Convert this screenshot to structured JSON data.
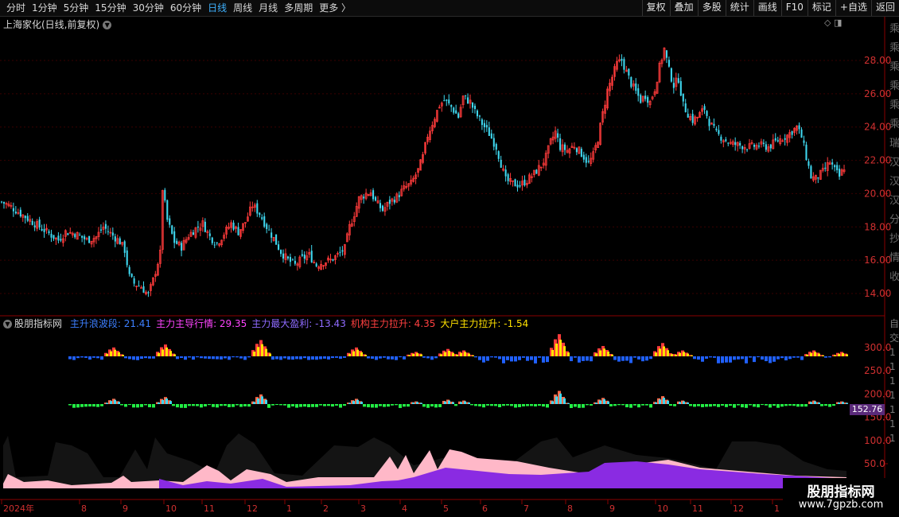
{
  "toolbar": {
    "periods": [
      {
        "label": "分时",
        "active": false
      },
      {
        "label": "1分钟",
        "active": false
      },
      {
        "label": "5分钟",
        "active": false
      },
      {
        "label": "15分钟",
        "active": false
      },
      {
        "label": "30分钟",
        "active": false
      },
      {
        "label": "60分钟",
        "active": false
      },
      {
        "label": "日线",
        "active": true
      },
      {
        "label": "周线",
        "active": false
      },
      {
        "label": "月线",
        "active": false
      },
      {
        "label": "多周期",
        "active": false
      },
      {
        "label": "更多 〉",
        "active": false
      }
    ],
    "actions": [
      "复权",
      "叠加",
      "多股",
      "统计",
      "画线",
      "F10",
      "标记",
      "+自选",
      "返回"
    ]
  },
  "main_chart": {
    "title": "上海家化(日线,前复权)",
    "icons": "◇ ◨",
    "y_ticks": [
      "28.00",
      "26.00",
      "24.00",
      "22.00",
      "20.00",
      "18.00",
      "16.00",
      "14.00"
    ],
    "right_side_glyphs": [
      "乘",
      "乘",
      "乘",
      "乘",
      "乘",
      "乘",
      "瑞",
      "汉",
      "汉",
      "汉",
      "分",
      "抄",
      "情",
      "收"
    ]
  },
  "indicator": {
    "name": "股朋指标网",
    "legend": [
      {
        "text": "主升浪波段: 21.41",
        "color": "#3d7fff"
      },
      {
        "text": "主力主导行情: 29.35",
        "color": "#ff44ff"
      },
      {
        "text": "主力最大盈利: -13.43",
        "color": "#8f6bff"
      },
      {
        "text": "机构主力拉升: 4.35",
        "color": "#ff4040"
      },
      {
        "text": "大户主力拉升: -1.54",
        "color": "#ffe100"
      }
    ],
    "y_ticks": [
      "300.0",
      "250.0",
      "200.0",
      "150.0",
      "100.0",
      "50.0"
    ],
    "current_value": "152.76",
    "side_labels": [
      "自",
      "交",
      "1",
      "1",
      "1",
      "1",
      "1",
      "1",
      "1"
    ]
  },
  "x_axis": {
    "labels": [
      "2024年",
      "8",
      "9",
      "10",
      "11",
      "12",
      "1",
      "2",
      "3",
      "4",
      "5",
      "6",
      "7",
      "8",
      "9",
      "10",
      "11",
      "12",
      "1"
    ]
  },
  "watermark": {
    "line1": "股朋指标网",
    "line2": "www.7gpzb.com"
  },
  "colors": {
    "up": "#ff3b3b",
    "down": "#3fd8f0",
    "active_tab": "#3fb2ff",
    "grid": "#3a0000",
    "axis_text": "#d03030"
  },
  "chart_data": {
    "type": "candlestick",
    "series_name": "上海家化(日线,前复权)",
    "price_path": [
      [
        0,
        19.5
      ],
      [
        3,
        19.3
      ],
      [
        8,
        18.8
      ],
      [
        14,
        18.2
      ],
      [
        20,
        17.6
      ],
      [
        24,
        17.2
      ],
      [
        27,
        17.7
      ],
      [
        31,
        17.6
      ],
      [
        36,
        17.2
      ],
      [
        40,
        17.4
      ],
      [
        43,
        18.0
      ],
      [
        46,
        17.6
      ],
      [
        50,
        17.1
      ],
      [
        52,
        16.6
      ],
      [
        54,
        15.0
      ],
      [
        56,
        14.6
      ],
      [
        59,
        14.4
      ],
      [
        62,
        13.9
      ],
      [
        64,
        14.8
      ],
      [
        67,
        16.4
      ],
      [
        68,
        20.3
      ],
      [
        70,
        18.4
      ],
      [
        73,
        17.1
      ],
      [
        76,
        16.8
      ],
      [
        79,
        17.5
      ],
      [
        82,
        17.9
      ],
      [
        85,
        18.2
      ],
      [
        88,
        17.4
      ],
      [
        91,
        17.0
      ],
      [
        94,
        17.6
      ],
      [
        97,
        18.2
      ],
      [
        100,
        17.7
      ],
      [
        103,
        18.3
      ],
      [
        106,
        19.3
      ],
      [
        109,
        18.8
      ],
      [
        112,
        18.0
      ],
      [
        115,
        17.3
      ],
      [
        118,
        16.5
      ],
      [
        121,
        16.0
      ],
      [
        124,
        15.7
      ],
      [
        127,
        16.1
      ],
      [
        130,
        16.3
      ],
      [
        133,
        15.7
      ],
      [
        136,
        15.9
      ],
      [
        139,
        16.0
      ],
      [
        142,
        16.3
      ],
      [
        145,
        16.7
      ],
      [
        147,
        18.0
      ],
      [
        149,
        18.8
      ],
      [
        151,
        19.7
      ],
      [
        154,
        20.0
      ],
      [
        156,
        20.1
      ],
      [
        158,
        19.5
      ],
      [
        161,
        19.0
      ],
      [
        164,
        19.5
      ],
      [
        167,
        19.8
      ],
      [
        170,
        20.3
      ],
      [
        173,
        20.6
      ],
      [
        176,
        21.4
      ],
      [
        178,
        22.2
      ],
      [
        180,
        23.5
      ],
      [
        183,
        24.6
      ],
      [
        185,
        25.3
      ],
      [
        187,
        25.6
      ],
      [
        190,
        25.2
      ],
      [
        193,
        24.6
      ],
      [
        195,
        25.8
      ],
      [
        198,
        25.5
      ],
      [
        200,
        24.9
      ],
      [
        203,
        24.2
      ],
      [
        206,
        23.6
      ],
      [
        209,
        22.8
      ],
      [
        211,
        21.8
      ],
      [
        213,
        20.8
      ],
      [
        216,
        20.6
      ],
      [
        219,
        20.5
      ],
      [
        222,
        20.8
      ],
      [
        225,
        21.2
      ],
      [
        228,
        21.7
      ],
      [
        230,
        22.2
      ],
      [
        232,
        23.1
      ],
      [
        234,
        23.7
      ],
      [
        236,
        22.8
      ],
      [
        239,
        22.6
      ],
      [
        242,
        22.9
      ],
      [
        245,
        22.4
      ],
      [
        248,
        21.8
      ],
      [
        250,
        22.3
      ],
      [
        252,
        23.3
      ],
      [
        254,
        24.8
      ],
      [
        256,
        26.2
      ],
      [
        258,
        27.0
      ],
      [
        260,
        27.8
      ],
      [
        262,
        28.0
      ],
      [
        264,
        27.3
      ],
      [
        266,
        26.6
      ],
      [
        268,
        26.1
      ],
      [
        270,
        25.6
      ],
      [
        272,
        25.9
      ],
      [
        274,
        25.5
      ],
      [
        276,
        26.3
      ],
      [
        278,
        27.6
      ],
      [
        280,
        28.7
      ],
      [
        282,
        27.4
      ],
      [
        284,
        26.5
      ],
      [
        286,
        26.9
      ],
      [
        288,
        25.3
      ],
      [
        290,
        24.8
      ],
      [
        292,
        24.4
      ],
      [
        294,
        24.6
      ],
      [
        297,
        25.1
      ],
      [
        299,
        24.3
      ],
      [
        302,
        23.6
      ],
      [
        305,
        23.3
      ],
      [
        308,
        23.0
      ],
      [
        312,
        22.9
      ],
      [
        316,
        22.8
      ],
      [
        320,
        22.9
      ],
      [
        324,
        22.8
      ],
      [
        328,
        23.2
      ],
      [
        332,
        23.5
      ],
      [
        336,
        24.0
      ],
      [
        338,
        23.4
      ],
      [
        340,
        22.2
      ],
      [
        342,
        21.0
      ],
      [
        344,
        20.9
      ],
      [
        347,
        21.3
      ],
      [
        350,
        21.9
      ],
      [
        352,
        21.4
      ],
      [
        354,
        21.0
      ],
      [
        356,
        21.6
      ]
    ],
    "y_range": [
      13.0,
      30.0
    ],
    "y_ticks": [
      14,
      16,
      18,
      20,
      22,
      24,
      26,
      28
    ],
    "candles": 357
  }
}
